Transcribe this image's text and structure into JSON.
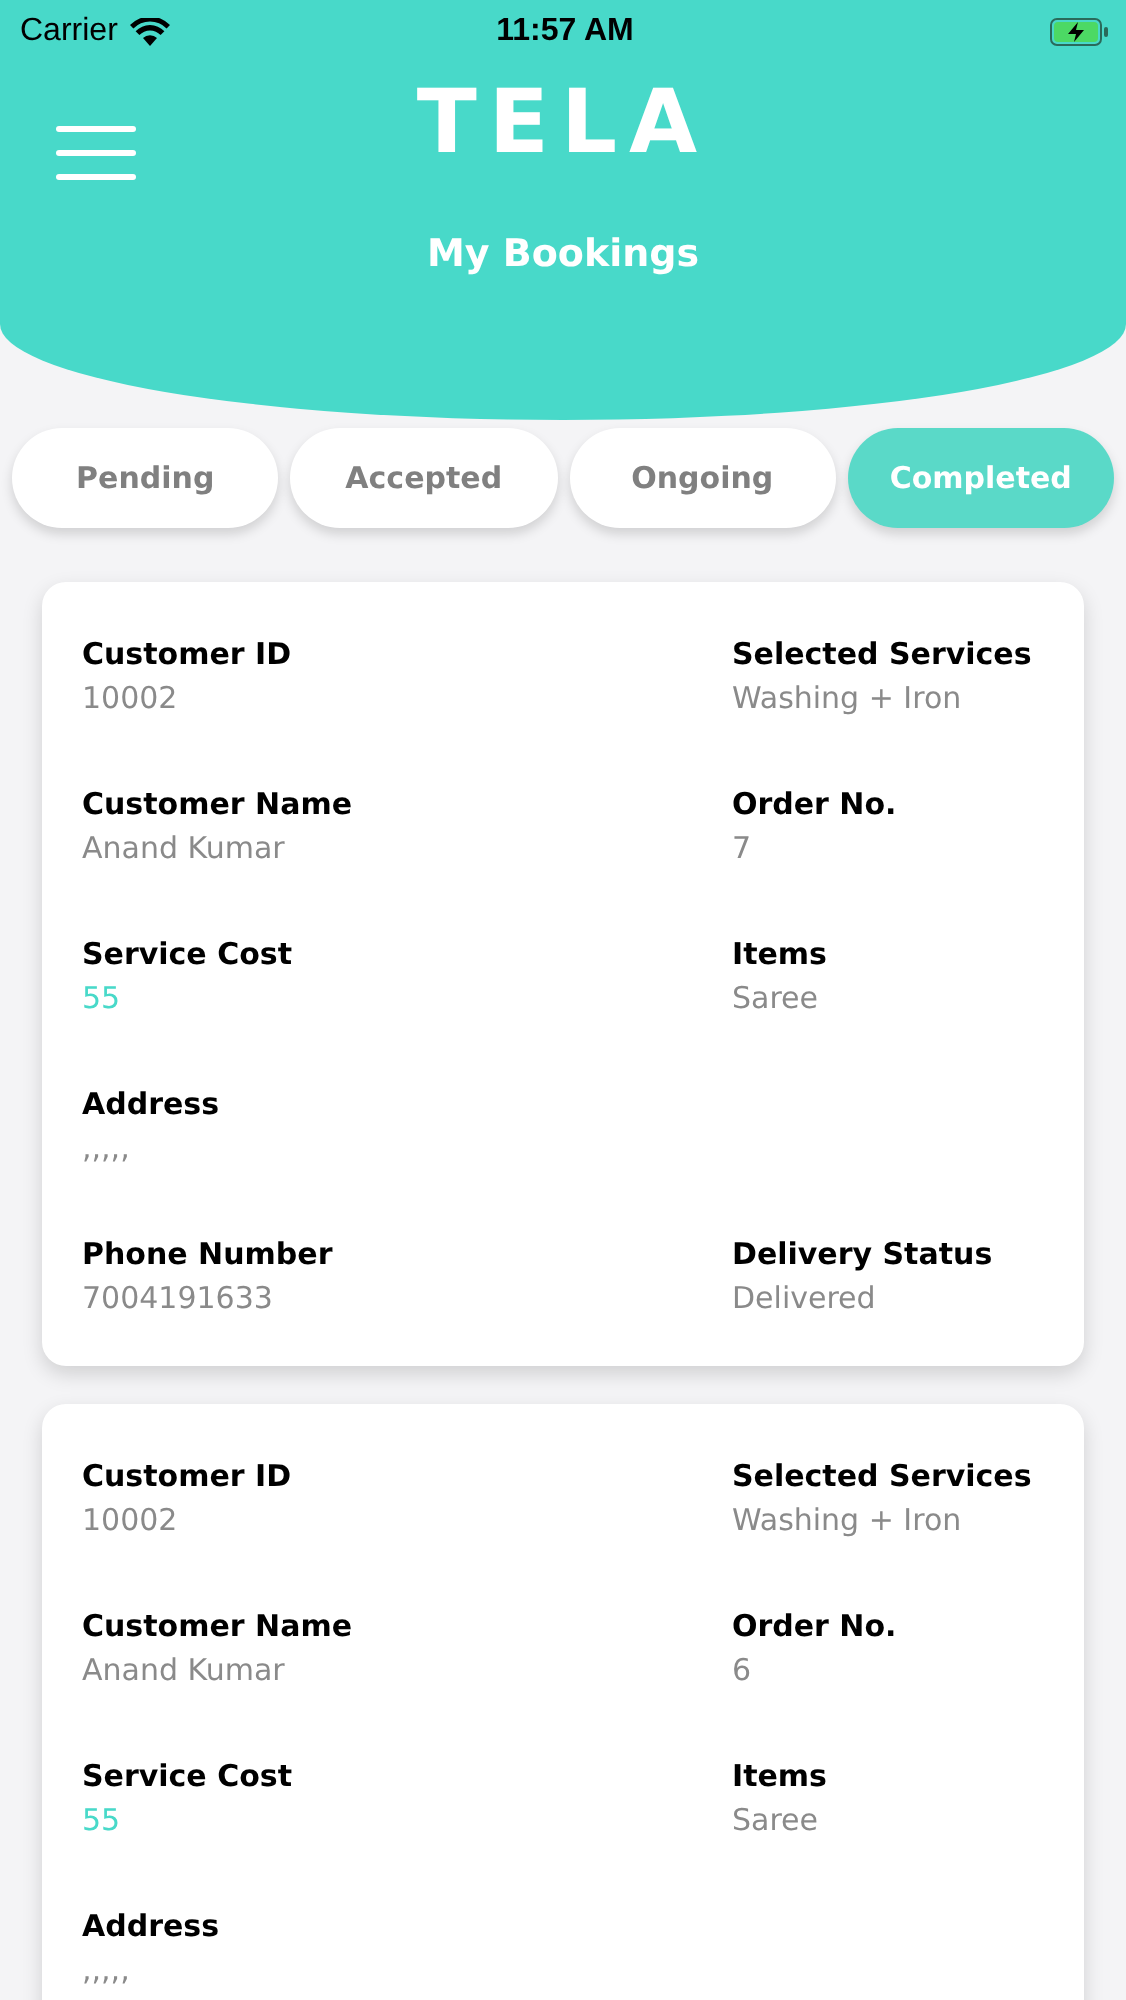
{
  "status_bar": {
    "carrier": "Carrier",
    "time": "11:57 AM"
  },
  "header": {
    "logo": "TELA",
    "title": "My Bookings"
  },
  "tabs": [
    {
      "label": "Pending",
      "selected": false
    },
    {
      "label": "Accepted",
      "selected": false
    },
    {
      "label": "Ongoing",
      "selected": false
    },
    {
      "label": "Completed",
      "selected": true
    }
  ],
  "bookings": [
    {
      "rows": [
        {
          "left": {
            "label": "Customer ID",
            "value": "10002"
          },
          "right": {
            "label": "Selected Services",
            "value": "Washing + Iron"
          }
        },
        {
          "left": {
            "label": "Customer Name",
            "value": "Anand Kumar"
          },
          "right": {
            "label": "Order No.",
            "value": "7"
          }
        },
        {
          "left": {
            "label": "Service Cost",
            "value": "55",
            "kind": "cost"
          },
          "right": {
            "label": "Items",
            "value": "Saree"
          }
        },
        {
          "left": {
            "label": "Address",
            "value": ",,,,,"
          }
        },
        {
          "left": {
            "label": "Phone Number",
            "value": "7004191633"
          },
          "right": {
            "label": "Delivery Status",
            "value": "Delivered"
          }
        }
      ]
    },
    {
      "rows": [
        {
          "left": {
            "label": "Customer ID",
            "value": "10002"
          },
          "right": {
            "label": "Selected Services",
            "value": "Washing + Iron"
          }
        },
        {
          "left": {
            "label": "Customer Name",
            "value": "Anand Kumar"
          },
          "right": {
            "label": "Order No.",
            "value": "6"
          }
        },
        {
          "left": {
            "label": "Service Cost",
            "value": "55",
            "kind": "cost"
          },
          "right": {
            "label": "Items",
            "value": "Saree"
          }
        },
        {
          "left": {
            "label": "Address",
            "value": ",,,,,"
          }
        }
      ]
    }
  ]
}
